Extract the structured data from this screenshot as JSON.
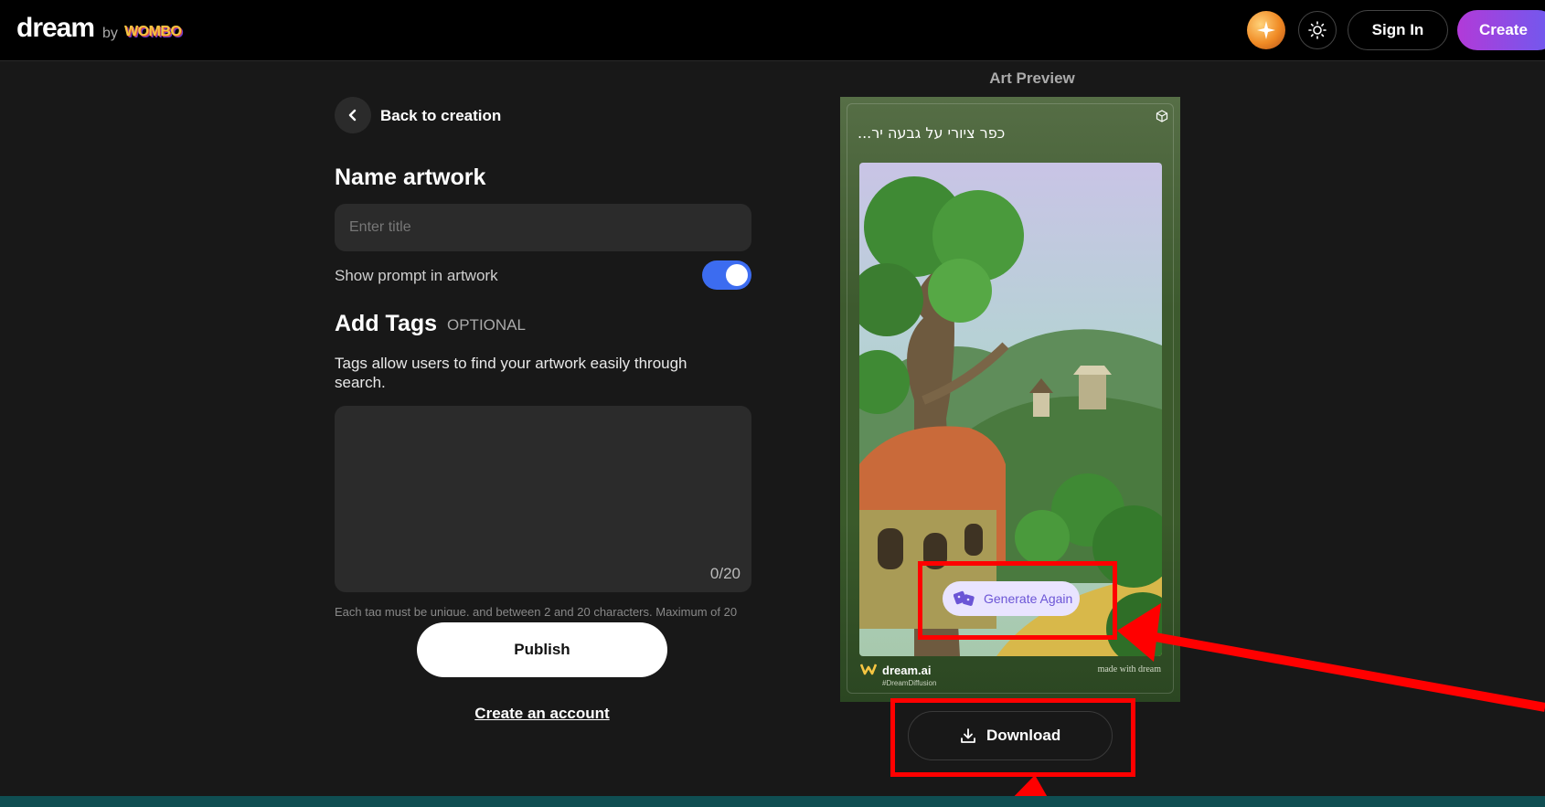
{
  "header": {
    "logo_main": "dream",
    "logo_by": "by",
    "logo_wombo": "WOMBO",
    "signin_label": "Sign In",
    "create_label": "Create"
  },
  "form": {
    "back_label": "Back to creation",
    "name_heading": "Name artwork",
    "title_placeholder": "Enter title",
    "title_value": "",
    "toggle_label": "Show prompt in artwork",
    "toggle_on": true,
    "tags_heading": "Add Tags",
    "tags_optional": "OPTIONAL",
    "tags_description": "Tags allow users to find your artwork easily through search.",
    "tags_count": "0/20",
    "tags_help": "Each tag must be unique, and between 2 and 20 characters. Maximum of 20",
    "publish_label": "Publish",
    "create_account_label": "Create an account"
  },
  "preview": {
    "section_label": "Art Preview",
    "prompt_text": "...כפר ציורי על גבעה יר",
    "generate_again_label": "Generate Again",
    "brand": "dream.ai",
    "hashtag": "#DreamDiffusion",
    "made_with": "made with dream",
    "download_label": "Download"
  },
  "colors": {
    "accent_toggle": "#3c6cf0",
    "create_gradient_start": "#b23ad8",
    "create_gradient_end": "#6b5cf0",
    "highlight": "#ff0000"
  }
}
